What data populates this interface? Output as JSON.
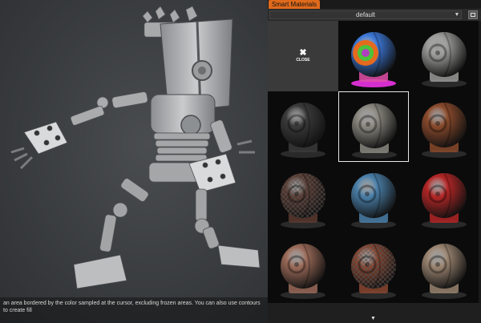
{
  "viewport": {
    "hint_text": "an area bordered by the color sampled at the cursor, excluding frozen areas. You can also use contours to create fill"
  },
  "panel": {
    "tab_label": "Smart Materials",
    "preset_value": "default",
    "close_label": "CLOSE",
    "materials": [
      {
        "name": "close"
      },
      {
        "name": "colored-id-material",
        "base": "#3c78d8"
      },
      {
        "name": "chrome-material",
        "base": "#9a9a98"
      },
      {
        "name": "dark-rubber-material",
        "base": "#3a3a3a"
      },
      {
        "name": "worn-steel-material",
        "base": "#8a8880"
      },
      {
        "name": "copper-rust-material",
        "base": "#8a4a2c"
      },
      {
        "name": "painted-pattern-material",
        "base": "#5a3a30"
      },
      {
        "name": "blue-paint-material",
        "base": "#4a7fa8"
      },
      {
        "name": "red-paint-material",
        "base": "#b42626"
      },
      {
        "name": "clay-material",
        "base": "#9a6a58"
      },
      {
        "name": "rust-pattern-material",
        "base": "#8a4630"
      },
      {
        "name": "sandstone-material",
        "base": "#9a8470"
      }
    ]
  }
}
